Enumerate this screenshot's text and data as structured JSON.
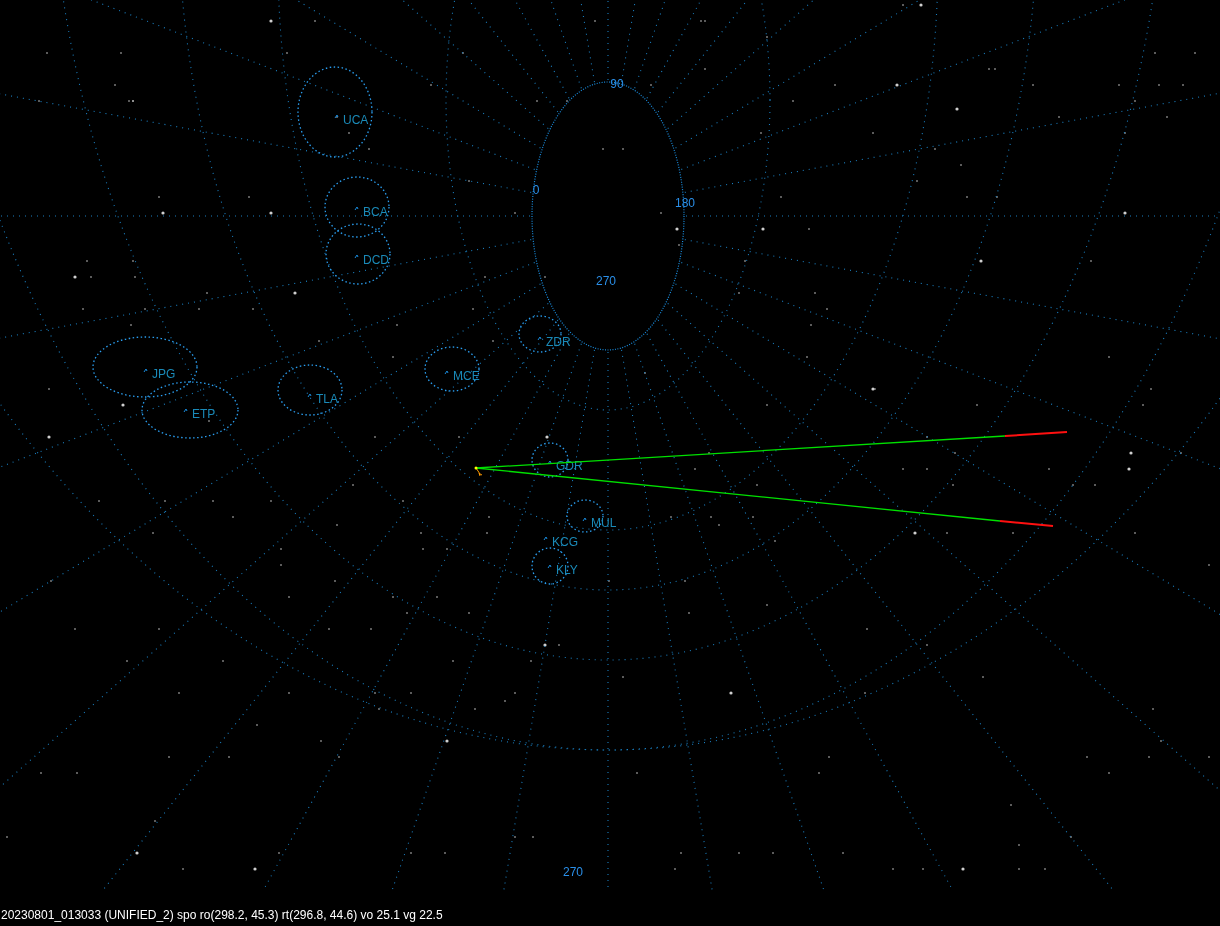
{
  "sky_map": {
    "scale_labels": [
      "90",
      "0",
      "180",
      "270"
    ],
    "radiants": [
      {
        "code": "UCA"
      },
      {
        "code": "BCA"
      },
      {
        "code": "DCD"
      },
      {
        "code": "ZDR"
      },
      {
        "code": "JPG"
      },
      {
        "code": "MCE"
      },
      {
        "code": "TLA"
      },
      {
        "code": "ETP"
      },
      {
        "code": "GDR"
      },
      {
        "code": "MUL"
      },
      {
        "code": "KCG"
      },
      {
        "code": "KLY"
      }
    ],
    "azimuth_label": "270"
  },
  "status_bar": "20230801_013033 (UNIFIED_2) spo ro(298.2, 45.3) rt(296.8, 44.6) vo 25.1 vg 22.5"
}
